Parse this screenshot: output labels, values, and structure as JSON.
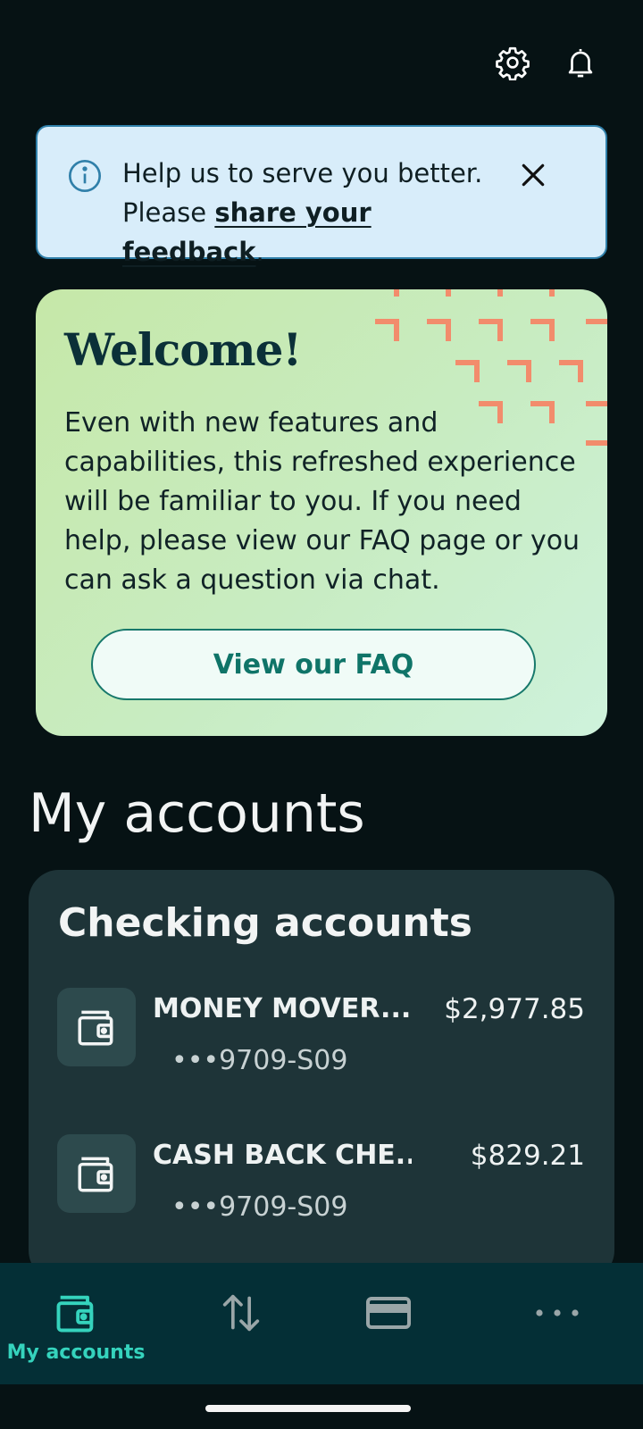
{
  "header": {
    "settings_icon": "gear-icon",
    "notifications_icon": "bell-icon"
  },
  "banner": {
    "line1": "Help us to serve you better.",
    "prefix": "Please ",
    "link": "share your feedback",
    "suffix": ".",
    "info_icon": "info-icon",
    "close_icon": "close-icon"
  },
  "welcome": {
    "title": "Welcome!",
    "body": "Even with new features and capabilities, this refreshed experience will be familiar to you. If you need help, please view our FAQ page or you can ask a question via chat.",
    "button": "View our FAQ"
  },
  "accounts": {
    "section_title": "My accounts",
    "card_title": "Checking accounts",
    "items": [
      {
        "name": "MONEY MOVER...",
        "number": "•••9709-S09",
        "balance": "$2,977.85"
      },
      {
        "name": "CASH BACK CHE...",
        "number": "•••9709-S09",
        "balance": "$829.21"
      }
    ]
  },
  "bottom_nav": {
    "items": [
      {
        "label": "My accounts",
        "icon": "wallet-icon",
        "active": true
      },
      {
        "label": "",
        "icon": "transfer-icon",
        "active": false
      },
      {
        "label": "",
        "icon": "card-icon",
        "active": false
      },
      {
        "label": "",
        "icon": "more-icon",
        "active": false
      }
    ]
  },
  "colors": {
    "background": "#061214",
    "banner_bg": "#d8edfa",
    "accent": "#35d3bd",
    "card_bg": "#1e3438",
    "decor": "#f28c6c"
  }
}
